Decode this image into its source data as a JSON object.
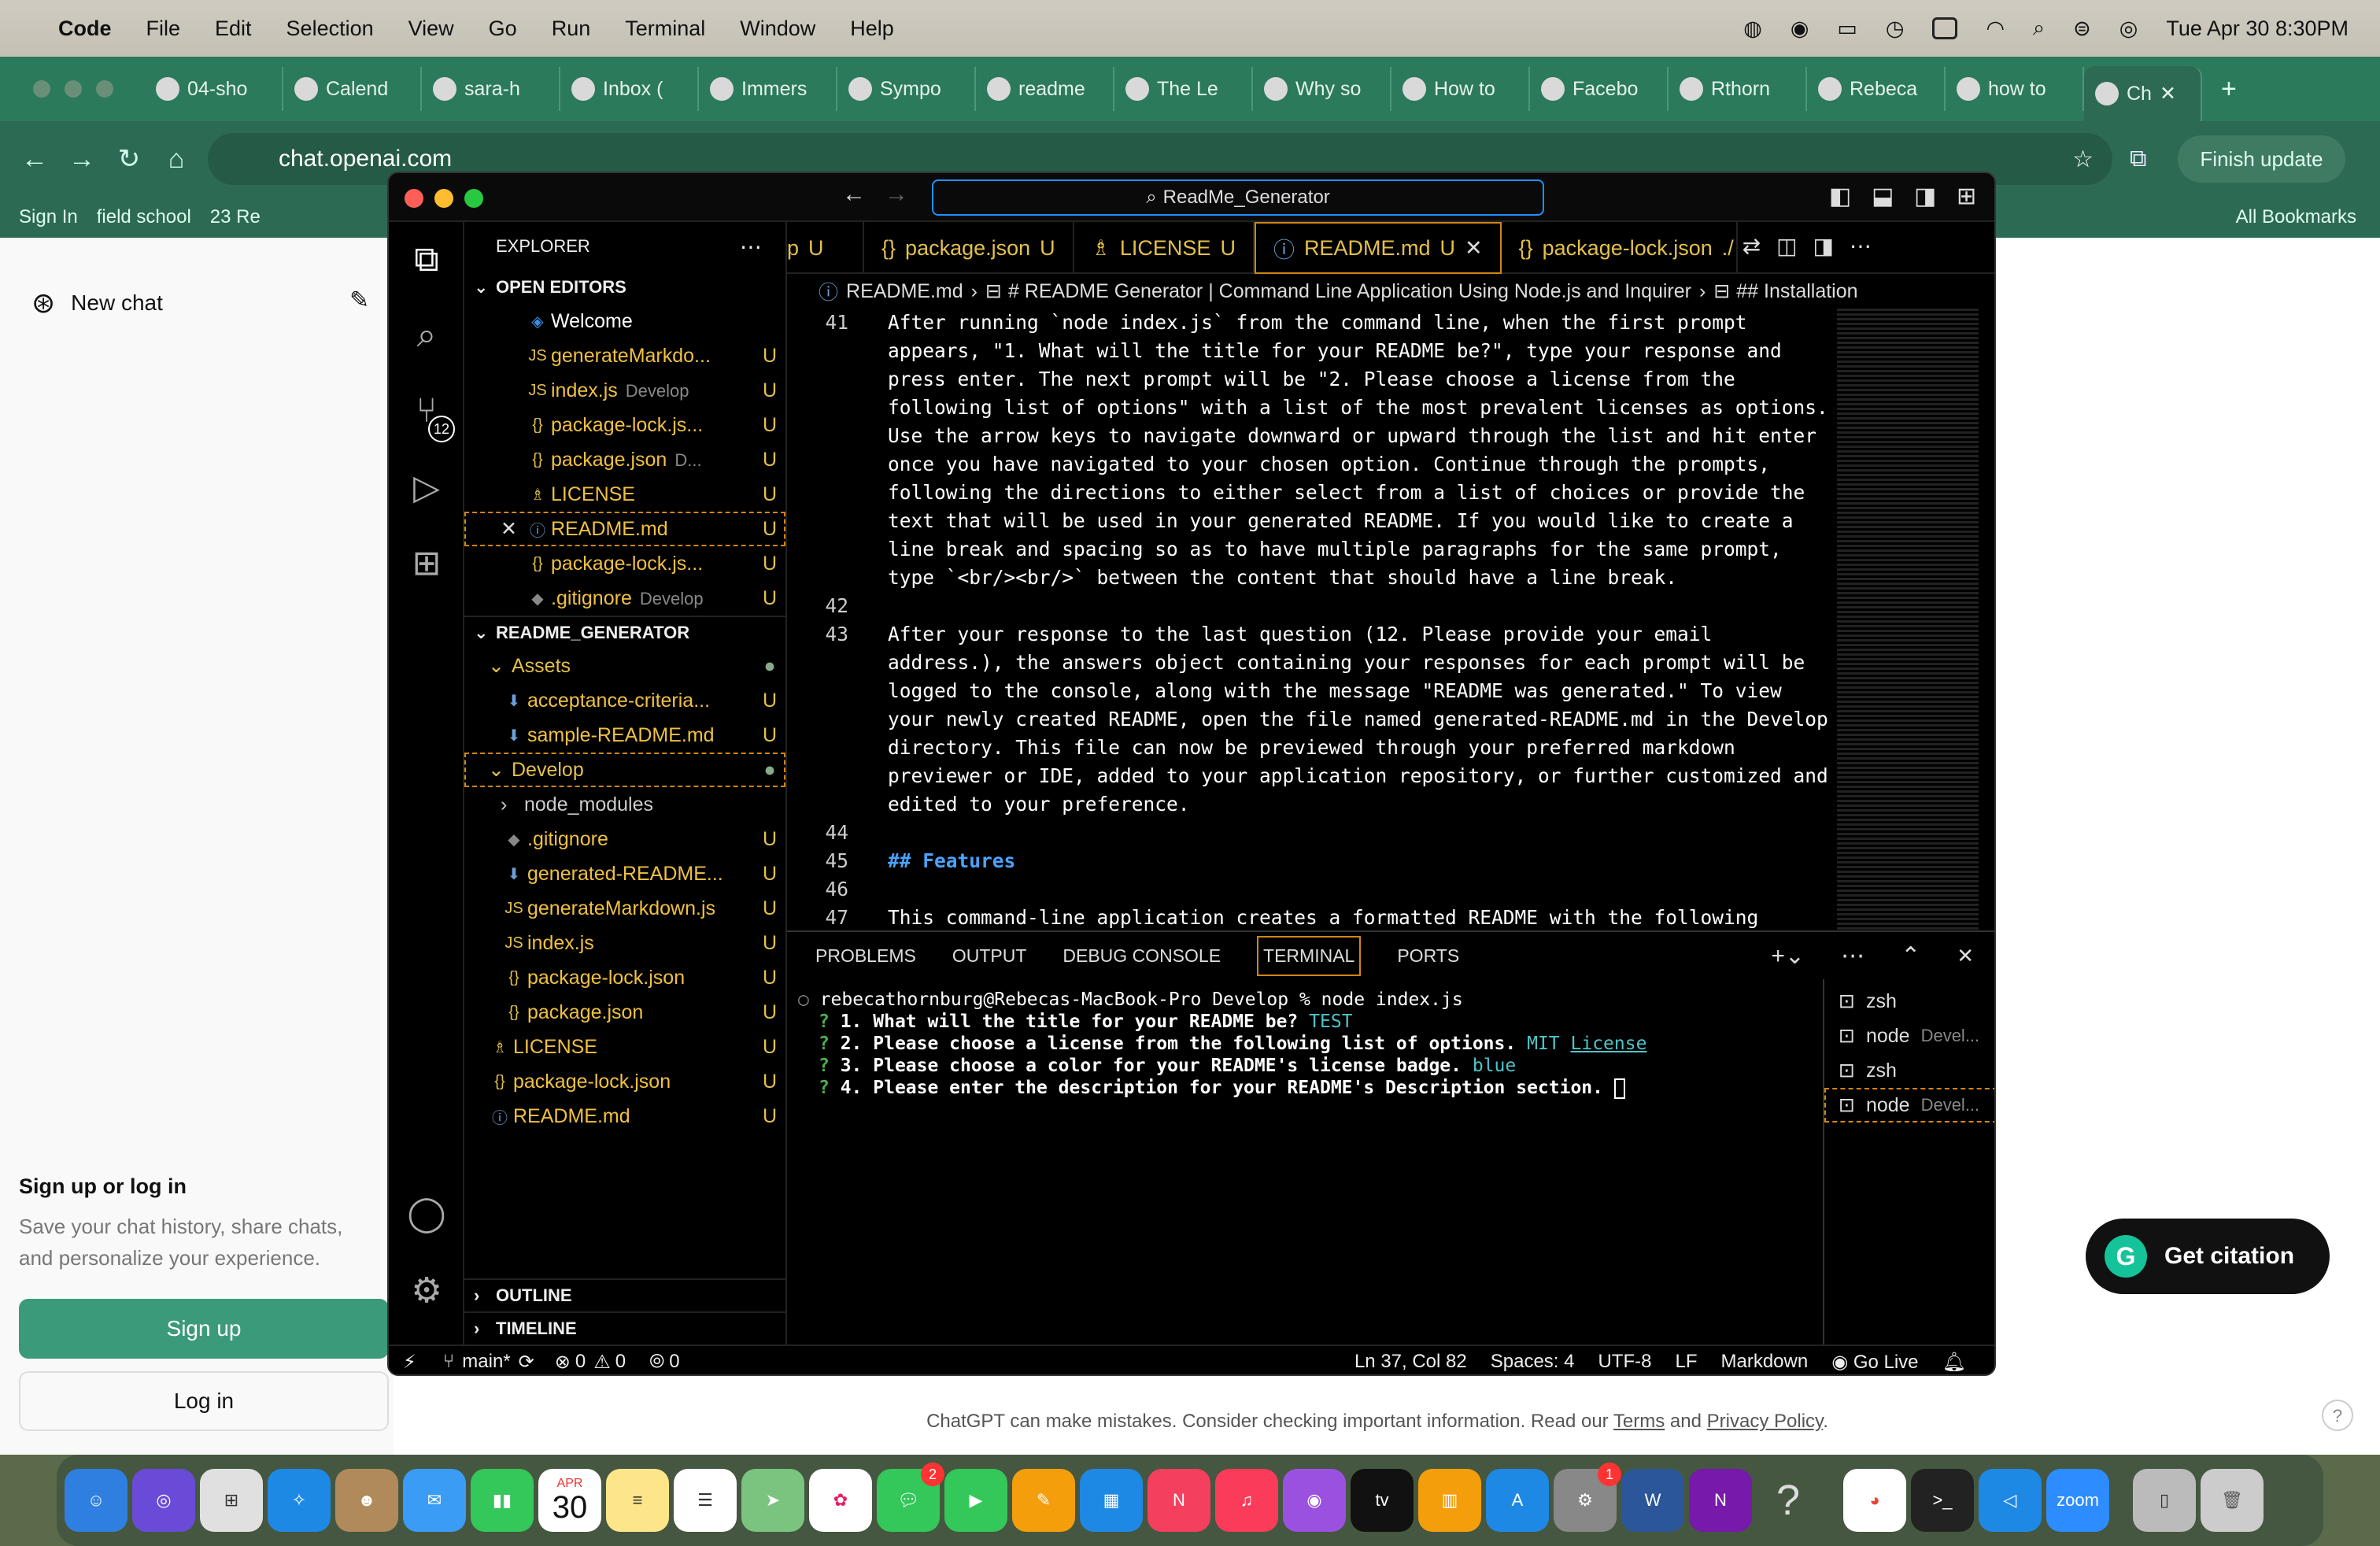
{
  "menubar": {
    "app_name": "Code",
    "items": [
      "File",
      "Edit",
      "Selection",
      "View",
      "Go",
      "Run",
      "Terminal",
      "Window",
      "Help"
    ],
    "datetime": "Tue Apr 30  8:30PM"
  },
  "browser": {
    "tabs": [
      "04-sho",
      "Calend",
      "sara-h",
      "Inbox (",
      "Immers",
      "Sympo",
      "readme",
      "The Le",
      "Why so",
      "How to",
      "Facebo",
      "Rthorn",
      "Rebeca",
      "how to",
      "Ch"
    ],
    "url": "chat.openai.com",
    "finish_update": "Finish update",
    "bookmarks": [
      "Sign In",
      "field school",
      "23 Re"
    ],
    "all_bookmarks": "All Bookmarks"
  },
  "chatgpt": {
    "new_chat": "New chat",
    "signup_heading": "Sign up or log in",
    "signup_text": "Save your chat history, share chats, and personalize your experience.",
    "signup_button": "Sign up",
    "login_button": "Log in",
    "footer_pre": "ChatGPT can make mistakes. Consider checking important information. Read our ",
    "footer_terms": "Terms",
    "footer_and": " and ",
    "footer_privacy": "Privacy Policy",
    "footer_end": "."
  },
  "citation": {
    "label": "Get citation"
  },
  "vscode": {
    "command_center": "ReadMe_Generator",
    "scm_badge": "12",
    "explorer_title": "EXPLORER",
    "open_editors_title": "OPEN EDITORS",
    "open_editors": [
      {
        "name": "Welcome",
        "sub": "",
        "status": ""
      },
      {
        "name": "generateMarkdo...",
        "sub": "",
        "status": "U"
      },
      {
        "name": "index.js",
        "sub": "Develop",
        "status": "U"
      },
      {
        "name": "package-lock.js...",
        "sub": "",
        "status": "U"
      },
      {
        "name": "package.json",
        "sub": "D...",
        "status": "U"
      },
      {
        "name": "LICENSE",
        "sub": "",
        "status": "U"
      },
      {
        "name": "README.md",
        "sub": "",
        "status": "U"
      },
      {
        "name": "package-lock.js...",
        "sub": "",
        "status": "U"
      },
      {
        "name": ".gitignore",
        "sub": "Develop",
        "status": "U"
      }
    ],
    "project_title": "README_GENERATOR",
    "tree": [
      {
        "name": "Assets",
        "status": "●"
      },
      {
        "name": "acceptance-criteria...",
        "status": "U"
      },
      {
        "name": "sample-README.md",
        "status": "U"
      },
      {
        "name": "Develop",
        "status": "●"
      },
      {
        "name": "node_modules",
        "status": ""
      },
      {
        "name": ".gitignore",
        "status": "U"
      },
      {
        "name": "generated-README...",
        "status": "U"
      },
      {
        "name": "generateMarkdown.js",
        "status": "U"
      },
      {
        "name": "index.js",
        "status": "U"
      },
      {
        "name": "package-lock.json",
        "status": "U"
      },
      {
        "name": "package.json",
        "status": "U"
      },
      {
        "name": "LICENSE",
        "status": "U"
      },
      {
        "name": "package-lock.json",
        "status": "U"
      },
      {
        "name": "README.md",
        "status": "U"
      }
    ],
    "outline": "OUTLINE",
    "timeline": "TIMELINE",
    "editor_tabs": [
      {
        "name": "p",
        "status": "U"
      },
      {
        "name": "package.json",
        "status": "U"
      },
      {
        "name": "LICENSE",
        "status": "U"
      },
      {
        "name": "README.md",
        "status": "U"
      },
      {
        "name": "package-lock.json",
        "status": "./ U"
      }
    ],
    "breadcrumb": [
      "README.md",
      "# README Generator | Command Line Application Using Node.js and Inquirer",
      "## Installation"
    ],
    "code_lines": [
      {
        "n": "41",
        "t": "After running `node index.js` from the command line, when the first prompt\nappears, \"1. What will the title for your README be?\", type your response and\npress enter. The next prompt will be \"2. Please choose a license from the\nfollowing list of options\" with a list of the most prevalent licenses as options.\nUse the arrow keys to navigate downward or upward through the list and hit enter\nonce you have navigated to your chosen option. Continue through the prompts,\nfollowing the directions to either select from a list of choices or provide the\ntext that will be used in your generated README. If you would like to create a\nline break and spacing so as to have multiple paragraphs for the same prompt,\ntype `<br/><br/>` between the content that should have a line break."
      },
      {
        "n": "42",
        "t": ""
      },
      {
        "n": "43",
        "t": "After your response to the last question (12. Please provide your email\naddress.), the answers object containing your responses for each prompt will be\nlogged to the console, along with the message \"README was generated.\" To view\nyour newly created README, open the file named generated-README.md in the Develop\ndirectory. This file can now be previewed through your preferred markdown\npreviewer or IDE, added to your application repository, or further customized and\nedited to your preference."
      },
      {
        "n": "44",
        "t": ""
      },
      {
        "n": "45",
        "t": "## Features"
      },
      {
        "n": "46",
        "t": ""
      },
      {
        "n": "47",
        "t": "This command-line application creates a formatted README with the following"
      }
    ],
    "panel_tabs": [
      "PROBLEMS",
      "OUTPUT",
      "DEBUG CONSOLE",
      "TERMINAL",
      "PORTS"
    ],
    "terminal": {
      "prompt": "rebecathornburg@Rebecas-MacBook-Pro Develop % node index.js",
      "q1": "1. What will the title for your README be?",
      "a1": "TEST",
      "q2": "2. Please choose a license from the following list of options.",
      "a2": "MIT",
      "a2_link": "License",
      "q3": "3. Please choose a color for your README's license badge.",
      "a3": "blue",
      "q4": "4. Please enter the description for your README's Description section."
    },
    "terminal_list": [
      {
        "name": "zsh",
        "sub": ""
      },
      {
        "name": "node",
        "sub": "Devel..."
      },
      {
        "name": "zsh",
        "sub": ""
      },
      {
        "name": "node",
        "sub": "Devel..."
      }
    ],
    "status": {
      "branch": "main*",
      "errors": "0",
      "warnings": "0",
      "ports": "0",
      "position": "Ln 37, Col 82",
      "spaces": "Spaces: 4",
      "encoding": "UTF-8",
      "eol": "LF",
      "language": "Markdown",
      "golive": "Go Live"
    }
  },
  "dock": {
    "calendar_month": "APR",
    "calendar_day": "30",
    "messages_badge": "2",
    "settings_badge": "1",
    "zoom_label": "zoom",
    "apps": [
      "finder-icon",
      "siri-icon",
      "launchpad-icon",
      "safari-icon",
      "contacts-icon",
      "mail-icon",
      "numbers-icon",
      "calendar-icon",
      "notes-icon",
      "reminders-icon",
      "maps-icon",
      "photos-icon",
      "messages-icon",
      "facetime-icon",
      "pages-icon",
      "keynote-icon",
      "news-icon",
      "music-icon",
      "podcasts-icon",
      "tv-icon",
      "books-icon",
      "appstore-icon",
      "settings-icon",
      "word-icon",
      "onenote-icon",
      "help-icon",
      "chrome-icon",
      "terminal-icon",
      "vscode-icon",
      "zoom-icon",
      "downloads-icon",
      "trash-icon"
    ]
  }
}
